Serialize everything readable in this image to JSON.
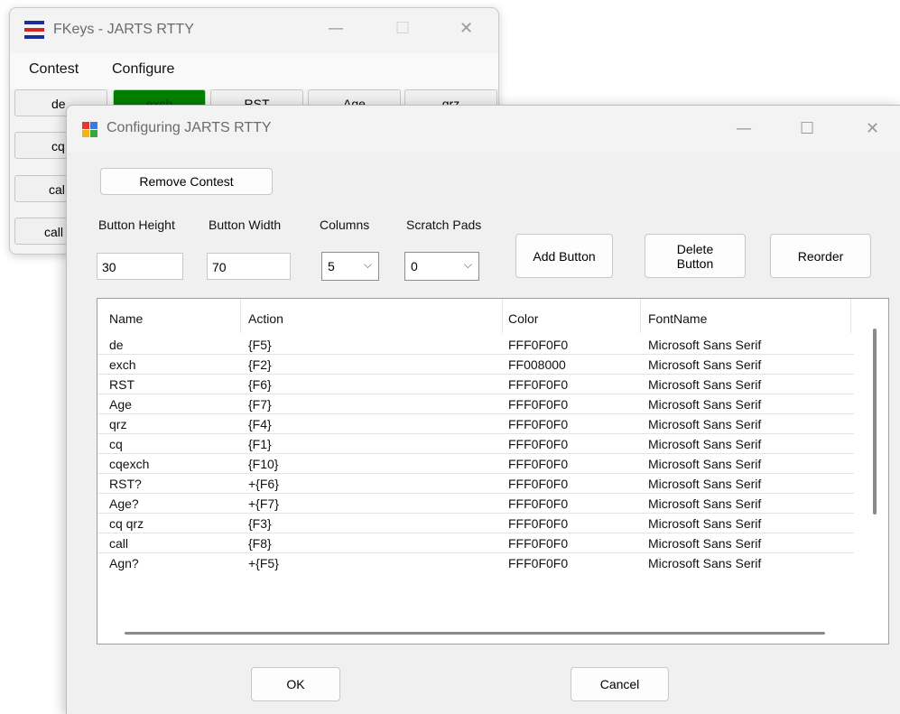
{
  "fkeys_window": {
    "title": "FKeys - JARTS RTTY",
    "minimize_glyph": "—",
    "maximize_glyph": "☐",
    "close_glyph": "✕",
    "menu": {
      "contest": "Contest",
      "configure": "Configure"
    },
    "buttons": [
      {
        "label": "de"
      },
      {
        "label": "exch"
      },
      {
        "label": "RST"
      },
      {
        "label": "Age"
      },
      {
        "label": "qrz"
      },
      {
        "label": "cq"
      },
      {
        "label": "cal"
      },
      {
        "label": "call"
      }
    ]
  },
  "dialog": {
    "title": "Configuring JARTS RTTY",
    "minimize_glyph": "—",
    "maximize_glyph": "☐",
    "close_glyph": "✕",
    "remove_contest_label": "Remove Contest",
    "button_height_label": "Button Height",
    "button_height_value": "30",
    "button_width_label": "Button Width",
    "button_width_value": "70",
    "columns_label": "Columns",
    "columns_value": "5",
    "scratch_pads_label": "Scratch Pads",
    "scratch_pads_value": "0",
    "add_button_label": "Add Button",
    "delete_button_label_1": "Delete",
    "delete_button_label_2": "Button",
    "reorder_label": "Reorder",
    "ok_label": "OK",
    "cancel_label": "Cancel",
    "grid": {
      "headers": [
        "Name",
        "Action",
        "Color",
        "FontName"
      ],
      "rows": [
        {
          "name": "de",
          "action": "{F5}",
          "color": "FFF0F0F0",
          "font": "Microsoft Sans Serif"
        },
        {
          "name": "exch",
          "action": "{F2}",
          "color": "FF008000",
          "font": "Microsoft Sans Serif"
        },
        {
          "name": "RST",
          "action": "{F6}",
          "color": "FFF0F0F0",
          "font": "Microsoft Sans Serif"
        },
        {
          "name": "Age",
          "action": "{F7}",
          "color": "FFF0F0F0",
          "font": "Microsoft Sans Serif"
        },
        {
          "name": "qrz",
          "action": "{F4}",
          "color": "FFF0F0F0",
          "font": "Microsoft Sans Serif"
        },
        {
          "name": "cq",
          "action": "{F1}",
          "color": "FFF0F0F0",
          "font": "Microsoft Sans Serif"
        },
        {
          "name": "cqexch",
          "action": "{F10}",
          "color": "FFF0F0F0",
          "font": "Microsoft Sans Serif"
        },
        {
          "name": "RST?",
          "action": "+{F6}",
          "color": "FFF0F0F0",
          "font": "Microsoft Sans Serif"
        },
        {
          "name": "Age?",
          "action": "+{F7}",
          "color": "FFF0F0F0",
          "font": "Microsoft Sans Serif"
        },
        {
          "name": "cq qrz",
          "action": "{F3}",
          "color": "FFF0F0F0",
          "font": "Microsoft Sans Serif"
        },
        {
          "name": "call",
          "action": "{F8}",
          "color": "FFF0F0F0",
          "font": "Microsoft Sans Serif"
        },
        {
          "name": "Agn?",
          "action": "+{F5}",
          "color": "FFF0F0F0",
          "font": "Microsoft Sans Serif"
        }
      ]
    }
  },
  "colors": {
    "exch_button": "#008000",
    "window_bg": "#f0f0f0"
  },
  "icons": [
    "app-flag-icon",
    "dialog-app-icon",
    "minimize-icon",
    "maximize-icon",
    "close-icon",
    "chevron-down-icon"
  ]
}
